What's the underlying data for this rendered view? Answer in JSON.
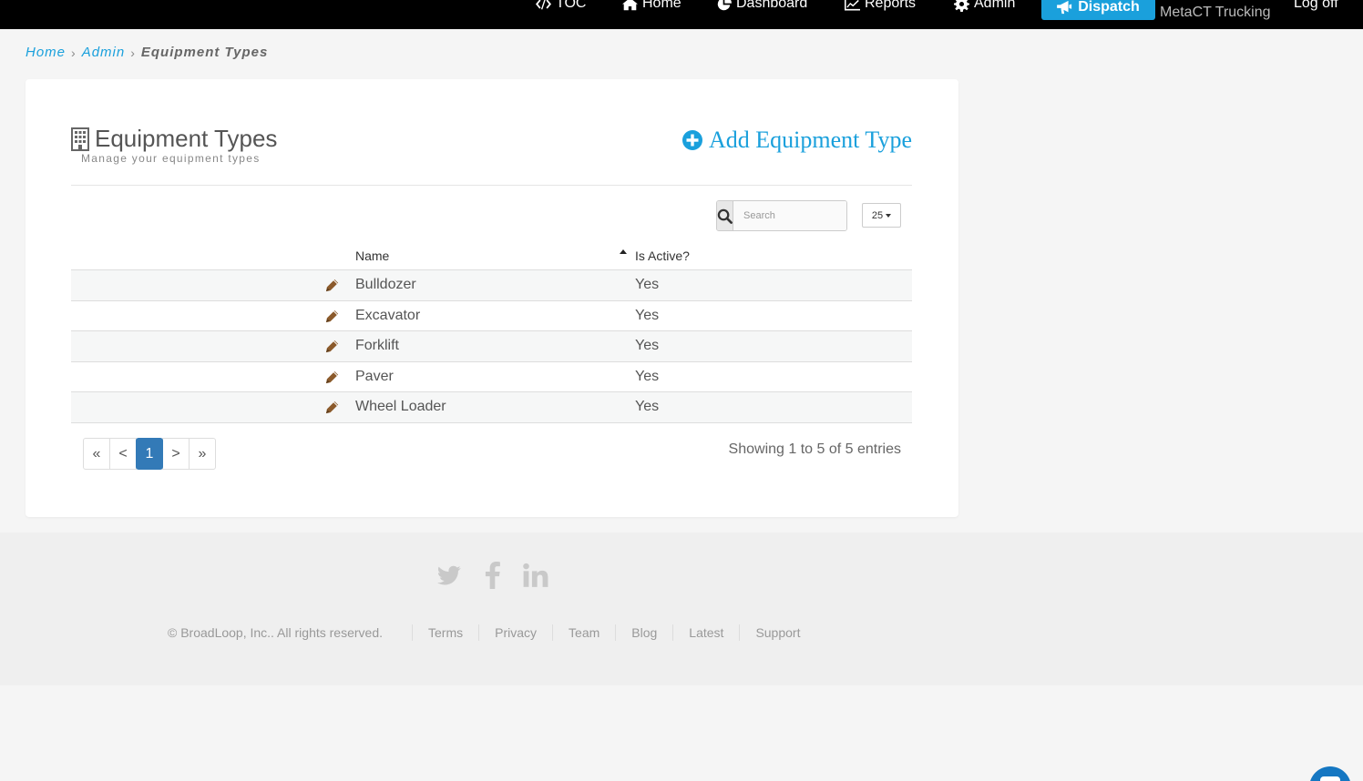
{
  "nav": {
    "items": [
      {
        "label": "TOC",
        "icon": "code-icon"
      },
      {
        "label": "Home",
        "icon": "home-icon"
      },
      {
        "label": "Dashboard",
        "icon": "pie-chart-icon"
      },
      {
        "label": "Reports",
        "icon": "line-chart-icon"
      },
      {
        "label": "Admin",
        "icon": "gear-icon"
      }
    ],
    "dispatch_label": "Dispatch",
    "company": "MetaCT Trucking",
    "logoff": "Log off"
  },
  "breadcrumb": {
    "home": "Home",
    "admin": "Admin",
    "current": "Equipment Types"
  },
  "page": {
    "title": "Equipment Types",
    "subtitle": "Manage your equipment types",
    "add_label": "Add Equipment Type"
  },
  "search": {
    "placeholder": "Search",
    "value": ""
  },
  "page_size": "25",
  "table": {
    "headers": {
      "name": "Name",
      "active": "Is Active?"
    },
    "rows": [
      {
        "name": "Bulldozer",
        "active": "Yes"
      },
      {
        "name": "Excavator",
        "active": "Yes"
      },
      {
        "name": "Forklift",
        "active": "Yes"
      },
      {
        "name": "Paver",
        "active": "Yes"
      },
      {
        "name": "Wheel Loader",
        "active": "Yes"
      }
    ]
  },
  "pagination": {
    "first": "«",
    "prev": "<",
    "current": "1",
    "next": ">",
    "last": "»",
    "summary": "Showing 1 to 5 of 5 entries"
  },
  "footer": {
    "copyright": "© BroadLoop, Inc.. All rights reserved.",
    "links": [
      "Terms",
      "Privacy",
      "Team",
      "Blog",
      "Latest",
      "Support"
    ],
    "social": [
      "twitter-icon",
      "facebook-icon",
      "linkedin-icon"
    ]
  },
  "colors": {
    "accent": "#1aa0dc",
    "pagination_active": "#337ab7",
    "nav_bg": "#000000",
    "edit_icon": "#8b5a2b"
  }
}
